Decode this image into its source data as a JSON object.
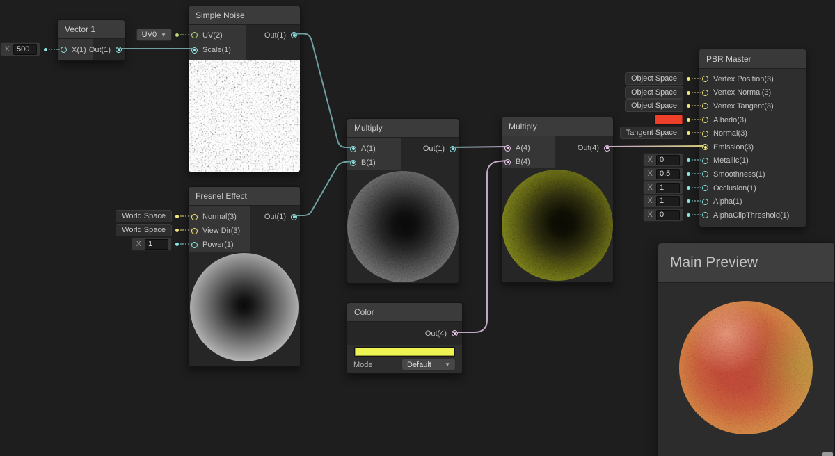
{
  "nodes": {
    "vector1": {
      "title": "Vector 1",
      "input_label": "X(1)",
      "output_label": "Out(1)",
      "field": {
        "label": "X",
        "value": "500"
      }
    },
    "simple_noise": {
      "title": "Simple Noise",
      "uv_label": "UV(2)",
      "scale_label": "Scale(1)",
      "output_label": "Out(1)",
      "uv_channel": "UV0"
    },
    "fresnel": {
      "title": "Fresnel Effect",
      "normal_label": "Normal(3)",
      "viewdir_label": "View Dir(3)",
      "power_label": "Power(1)",
      "output_label": "Out(1)",
      "normal_space": "World Space",
      "viewdir_space": "World Space",
      "power_field": {
        "label": "X",
        "value": "1"
      }
    },
    "multiply1": {
      "title": "Multiply",
      "a_label": "A(1)",
      "b_label": "B(1)",
      "output_label": "Out(1)"
    },
    "multiply2": {
      "title": "Multiply",
      "a_label": "A(4)",
      "b_label": "B(4)",
      "output_label": "Out(4)"
    },
    "color": {
      "title": "Color",
      "output_label": "Out(4)",
      "swatch_color": "#edf353",
      "mode_label": "Mode",
      "mode_value": "Default"
    },
    "pbr": {
      "title": "PBR Master",
      "ports": [
        {
          "label": "Vertex Position(3)",
          "widget": "Object Space"
        },
        {
          "label": "Vertex Normal(3)",
          "widget": "Object Space"
        },
        {
          "label": "Vertex Tangent(3)",
          "widget": "Object Space"
        },
        {
          "label": "Albedo(3)",
          "swatch_color": "#ee3f2b"
        },
        {
          "label": "Normal(3)",
          "widget": "Tangent Space"
        },
        {
          "label": "Emission(3)"
        },
        {
          "label": "Metallic(1)",
          "field_label": "X",
          "field_value": "0"
        },
        {
          "label": "Smoothness(1)",
          "field_label": "X",
          "field_value": "0.5"
        },
        {
          "label": "Occlusion(1)",
          "field_label": "X",
          "field_value": "1"
        },
        {
          "label": "Alpha(1)",
          "field_label": "X",
          "field_value": "1"
        },
        {
          "label": "AlphaClipThreshold(1)",
          "field_label": "X",
          "field_value": "0"
        }
      ]
    }
  },
  "main_preview": {
    "title": "Main Preview"
  },
  "icons": {
    "dropdown_arrow": "▼"
  },
  "colors": {
    "wire_float": "#6ea0a1",
    "wire_vector4": "#c3a7c8",
    "wire_vector3": "#d5cd7a",
    "port_vec1": "#8ce8e4",
    "port_vec2": "#b9d878",
    "port_vec3": "#f3e87e",
    "port_vec4": "#e9c9ea",
    "background": "#1e1e1e"
  }
}
